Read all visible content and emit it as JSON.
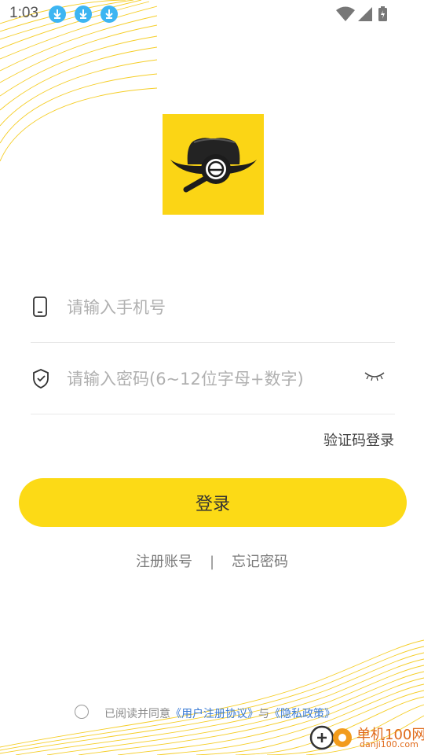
{
  "status_bar": {
    "time": "1:03",
    "notification_icons": [
      "download-icon",
      "download-icon",
      "download-icon"
    ],
    "right_icons": [
      "wifi-icon",
      "signal-icon",
      "battery-charging-icon"
    ]
  },
  "logo": {
    "icon": "detective-hat-magnifier-logo",
    "background": "#fbd515"
  },
  "form": {
    "phone_placeholder": "请输入手机号",
    "phone_icon": "phone-icon",
    "password_placeholder": "请输入密码(6~12位字母+数字)",
    "password_icon": "shield-check-icon",
    "toggle_icon": "eye-closed-icon"
  },
  "code_login_label": "验证码登录",
  "login_button_label": "登录",
  "links": {
    "register": "注册账号",
    "separator": "|",
    "forgot": "忘记密码"
  },
  "agreement": {
    "prefix": "已阅读并同意",
    "user_agreement": "《用户注册协议》",
    "and": "与",
    "privacy_policy": "《隐私政策》"
  },
  "watermark": {
    "title": "单机100网",
    "url": "danji100.com"
  },
  "colors": {
    "accent": "#fcda16",
    "link": "#3a7bd5",
    "status_download": "#3db5f2"
  }
}
